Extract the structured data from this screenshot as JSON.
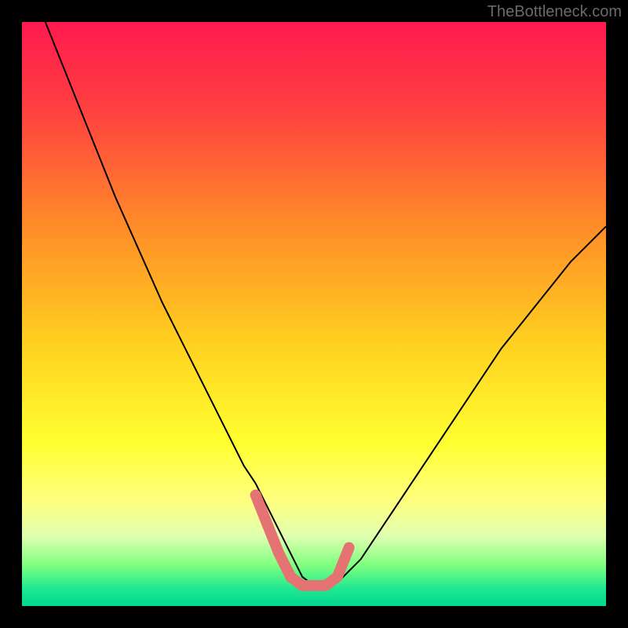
{
  "watermark": "TheBottleneck.com",
  "chart_data": {
    "type": "line",
    "title": "",
    "xlabel": "",
    "ylabel": "",
    "xlim": [
      0,
      100
    ],
    "ylim": [
      0,
      100
    ],
    "background": {
      "type": "vertical_gradient",
      "stops": [
        {
          "offset": 0.0,
          "color": "#ff1a4f"
        },
        {
          "offset": 0.15,
          "color": "#ff4040"
        },
        {
          "offset": 0.35,
          "color": "#ff8c28"
        },
        {
          "offset": 0.55,
          "color": "#ffd020"
        },
        {
          "offset": 0.72,
          "color": "#ffff30"
        },
        {
          "offset": 0.82,
          "color": "#ffff80"
        },
        {
          "offset": 0.88,
          "color": "#e0ffb0"
        },
        {
          "offset": 0.93,
          "color": "#80ff80"
        },
        {
          "offset": 0.97,
          "color": "#20e890"
        },
        {
          "offset": 1.0,
          "color": "#00d890"
        }
      ]
    },
    "series": [
      {
        "name": "bottleneck-curve",
        "type": "line",
        "color": "#000000",
        "width": 2,
        "x": [
          4,
          8,
          12,
          16,
          20,
          24,
          28,
          32,
          36,
          38,
          40,
          42,
          44,
          46,
          48,
          50,
          52,
          54,
          58,
          62,
          66,
          70,
          74,
          78,
          82,
          86,
          90,
          94,
          98,
          100
        ],
        "y": [
          100,
          90,
          80,
          70,
          61,
          52,
          44,
          36,
          28,
          24,
          21,
          17,
          13,
          9,
          5,
          3.5,
          3.5,
          4,
          8,
          14,
          20,
          26,
          32,
          38,
          44,
          49,
          54,
          59,
          63,
          65
        ]
      },
      {
        "name": "valley-marker",
        "type": "line",
        "color": "#e57373",
        "width": 14,
        "linecap": "round",
        "x": [
          40,
          42,
          44,
          46,
          48,
          50,
          52,
          54,
          56
        ],
        "y": [
          19,
          14,
          9,
          5,
          3.5,
          3.5,
          3.5,
          5,
          10
        ]
      }
    ],
    "frame": {
      "color": "#000000",
      "width": 28
    }
  }
}
